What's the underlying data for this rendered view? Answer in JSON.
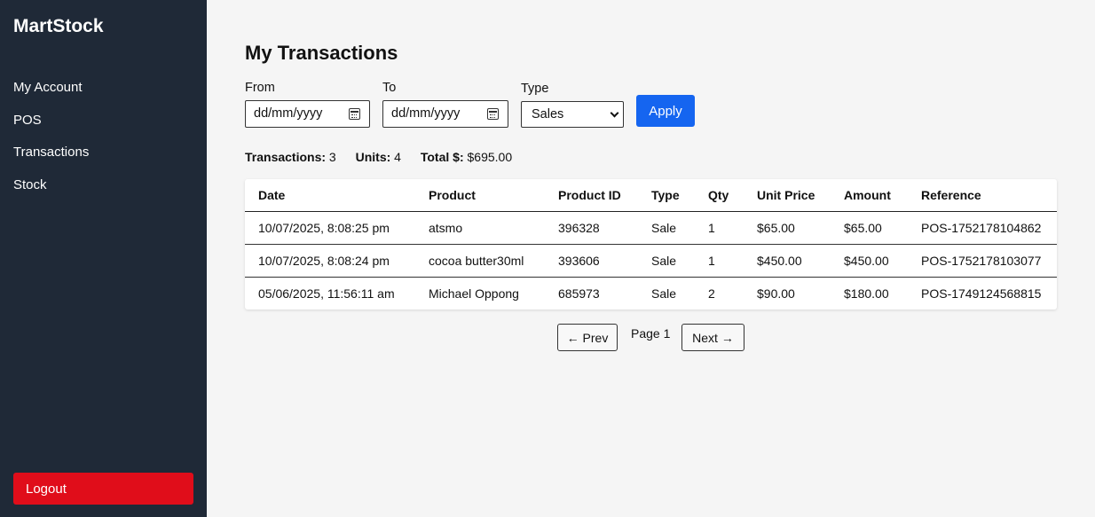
{
  "app": {
    "title": "MartStock"
  },
  "sidebar": {
    "items": [
      {
        "label": "My Account"
      },
      {
        "label": "POS"
      },
      {
        "label": "Transactions"
      },
      {
        "label": "Stock"
      }
    ],
    "logout_label": "Logout"
  },
  "page": {
    "title": "My Transactions"
  },
  "filters": {
    "from_label": "From",
    "from_placeholder": "dd/mm/yyyy",
    "to_label": "To",
    "to_placeholder": "dd/mm/yyyy",
    "type_label": "Type",
    "type_value": "Sales",
    "apply_label": "Apply"
  },
  "summary": {
    "transactions_label": "Transactions:",
    "transactions_value": "3",
    "units_label": "Units:",
    "units_value": "4",
    "total_label": "Total $:",
    "total_value": "$695.00"
  },
  "table": {
    "headers": [
      "Date",
      "Product",
      "Product ID",
      "Type",
      "Qty",
      "Unit Price",
      "Amount",
      "Reference"
    ],
    "rows": [
      [
        "10/07/2025, 8:08:25 pm",
        "atsmo",
        "396328",
        "Sale",
        "1",
        "$65.00",
        "$65.00",
        "POS-1752178104862"
      ],
      [
        "10/07/2025, 8:08:24 pm",
        "cocoa butter30ml",
        "393606",
        "Sale",
        "1",
        "$450.00",
        "$450.00",
        "POS-1752178103077"
      ],
      [
        "05/06/2025, 11:56:11 am",
        "Michael Oppong",
        "685973",
        "Sale",
        "2",
        "$90.00",
        "$180.00",
        "POS-1749124568815"
      ]
    ]
  },
  "pagination": {
    "prev_label": "← Prev",
    "page_label": "Page 1",
    "next_label": "Next →"
  },
  "colors": {
    "sidebar_bg": "#1f2937",
    "main_bg": "#f5f5f5",
    "accent": "#1565f0",
    "logout": "#e00d1a"
  }
}
